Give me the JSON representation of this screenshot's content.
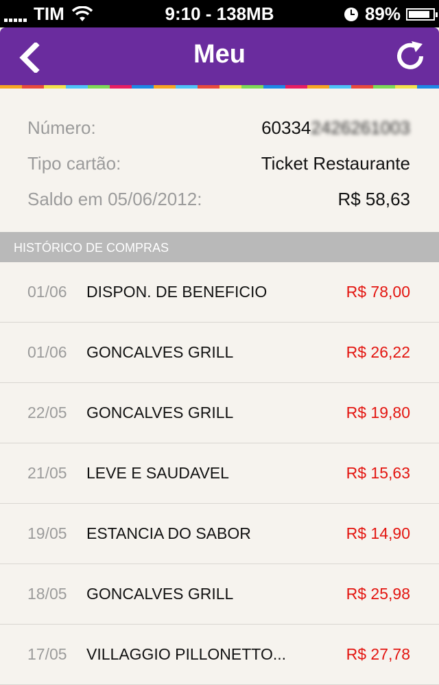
{
  "status_bar": {
    "carrier": "TIM",
    "time": "9:10 - 138MB",
    "battery": "89%",
    "battery_level": 0.89
  },
  "nav": {
    "title": "Meu",
    "back_icon": "chevron-left-icon",
    "refresh_icon": "refresh-icon",
    "rainbow_colors": [
      "#f5a623",
      "#e84b3c",
      "#f2e14c",
      "#4fc3f7",
      "#7ed957",
      "#e91e63",
      "#1e88e5",
      "#f5a623",
      "#4fc3f7",
      "#e84b3c",
      "#f2e14c",
      "#7ed957",
      "#1e88e5",
      "#e91e63",
      "#f5a623",
      "#4fc3f7",
      "#e84b3c",
      "#7ed957",
      "#f2e14c",
      "#1e88e5"
    ]
  },
  "card": {
    "number_label": "Número:",
    "number_value": "60334",
    "number_masked": "2426261003",
    "type_label": "Tipo cartão:",
    "type_value": "Ticket Restaurante",
    "balance_label": "Saldo em 05/06/2012:",
    "balance_value": "R$ 58,63"
  },
  "history": {
    "header": "HISTÓRICO DE COMPRAS",
    "rows": [
      {
        "date": "01/06",
        "desc": "DISPON. DE BENEFICIO",
        "amount": "R$ 78,00"
      },
      {
        "date": "01/06",
        "desc": "GONCALVES GRILL",
        "amount": "R$ 26,22"
      },
      {
        "date": "22/05",
        "desc": "GONCALVES GRILL",
        "amount": "R$ 19,80"
      },
      {
        "date": "21/05",
        "desc": "LEVE E SAUDAVEL",
        "amount": "R$ 15,63"
      },
      {
        "date": "19/05",
        "desc": "ESTANCIA DO SABOR",
        "amount": "R$ 14,90"
      },
      {
        "date": "18/05",
        "desc": "GONCALVES GRILL",
        "amount": "R$ 25,98"
      },
      {
        "date": "17/05",
        "desc": "VILLAGGIO PILLONETTO...",
        "amount": "R$ 27,78"
      }
    ]
  }
}
